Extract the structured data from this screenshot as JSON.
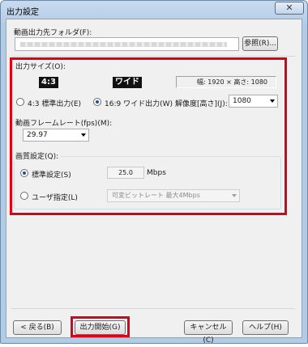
{
  "window": {
    "title": "出力設定",
    "close_glyph": "✕"
  },
  "folder": {
    "label": "動画出力先フォルダ(F):",
    "value": "",
    "browse_label": "参照(R)..."
  },
  "size": {
    "group_title": "出力サイズ(O):",
    "badge_43": "4:3",
    "badge_wide": "ワイド",
    "info": "幅: 1920 × 高さ: 1080",
    "radio_43_label": "4:3  標準出力(E)",
    "radio_169_label": "16:9 ワイド出力(W)",
    "selected": "16:9",
    "resolution_label": "解像度[高さ](J):",
    "resolution_value": "1080"
  },
  "framerate": {
    "label": "動画フレームレート(fps)(M):",
    "value": "29.97"
  },
  "quality": {
    "group_title": "画質設定(Q):",
    "standard_label": "標準設定(S)",
    "standard_value": "25.0",
    "unit": "Mbps",
    "user_label": "ユーザ指定(L)",
    "user_value": "可変ビットレート 最大4Mbps",
    "selected": "standard"
  },
  "buttons": {
    "back": "< 戻る(B)",
    "start": "出力開始(G)",
    "cancel": "キャンセル(C)",
    "help": "ヘルプ(H)"
  },
  "highlight_color": "#e00016"
}
